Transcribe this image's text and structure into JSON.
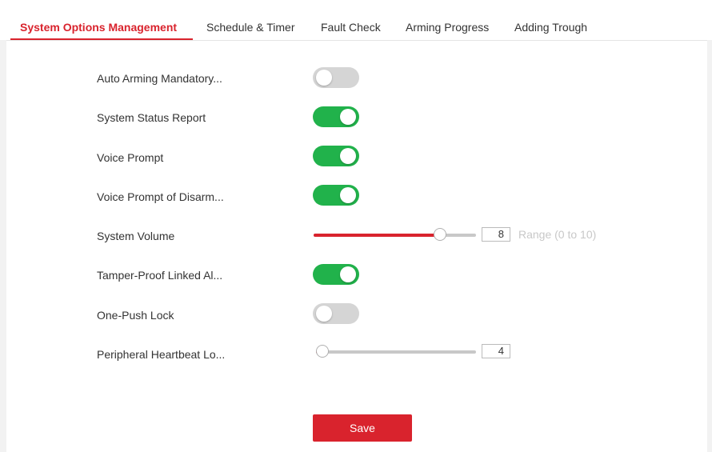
{
  "tabs": [
    {
      "label": "System Options Management",
      "active": true
    },
    {
      "label": "Schedule & Timer",
      "active": false
    },
    {
      "label": "Fault Check",
      "active": false
    },
    {
      "label": "Arming Progress",
      "active": false
    },
    {
      "label": "Adding Trough",
      "active": false
    }
  ],
  "settings": {
    "auto_arming": {
      "label": "Auto Arming Mandatory...",
      "enabled": false
    },
    "status_report": {
      "label": "System Status Report",
      "enabled": true
    },
    "voice_prompt": {
      "label": "Voice Prompt",
      "enabled": true
    },
    "voice_prompt_disarm": {
      "label": "Voice Prompt of Disarm...",
      "enabled": true
    },
    "system_volume": {
      "label": "System Volume",
      "value": "8",
      "fraction": 0.8,
      "range_hint": "Range (0 to 10)"
    },
    "tamper_proof": {
      "label": "Tamper-Proof Linked Al...",
      "enabled": true
    },
    "one_push_lock": {
      "label": "One-Push Lock",
      "enabled": false
    },
    "heartbeat": {
      "label": "Peripheral Heartbeat Lo...",
      "value": "4",
      "fraction": 0.0
    }
  },
  "save_label": "Save",
  "colors": {
    "accent": "#d9232d",
    "toggle_on": "#21b24b",
    "toggle_off": "#d5d5d5"
  }
}
